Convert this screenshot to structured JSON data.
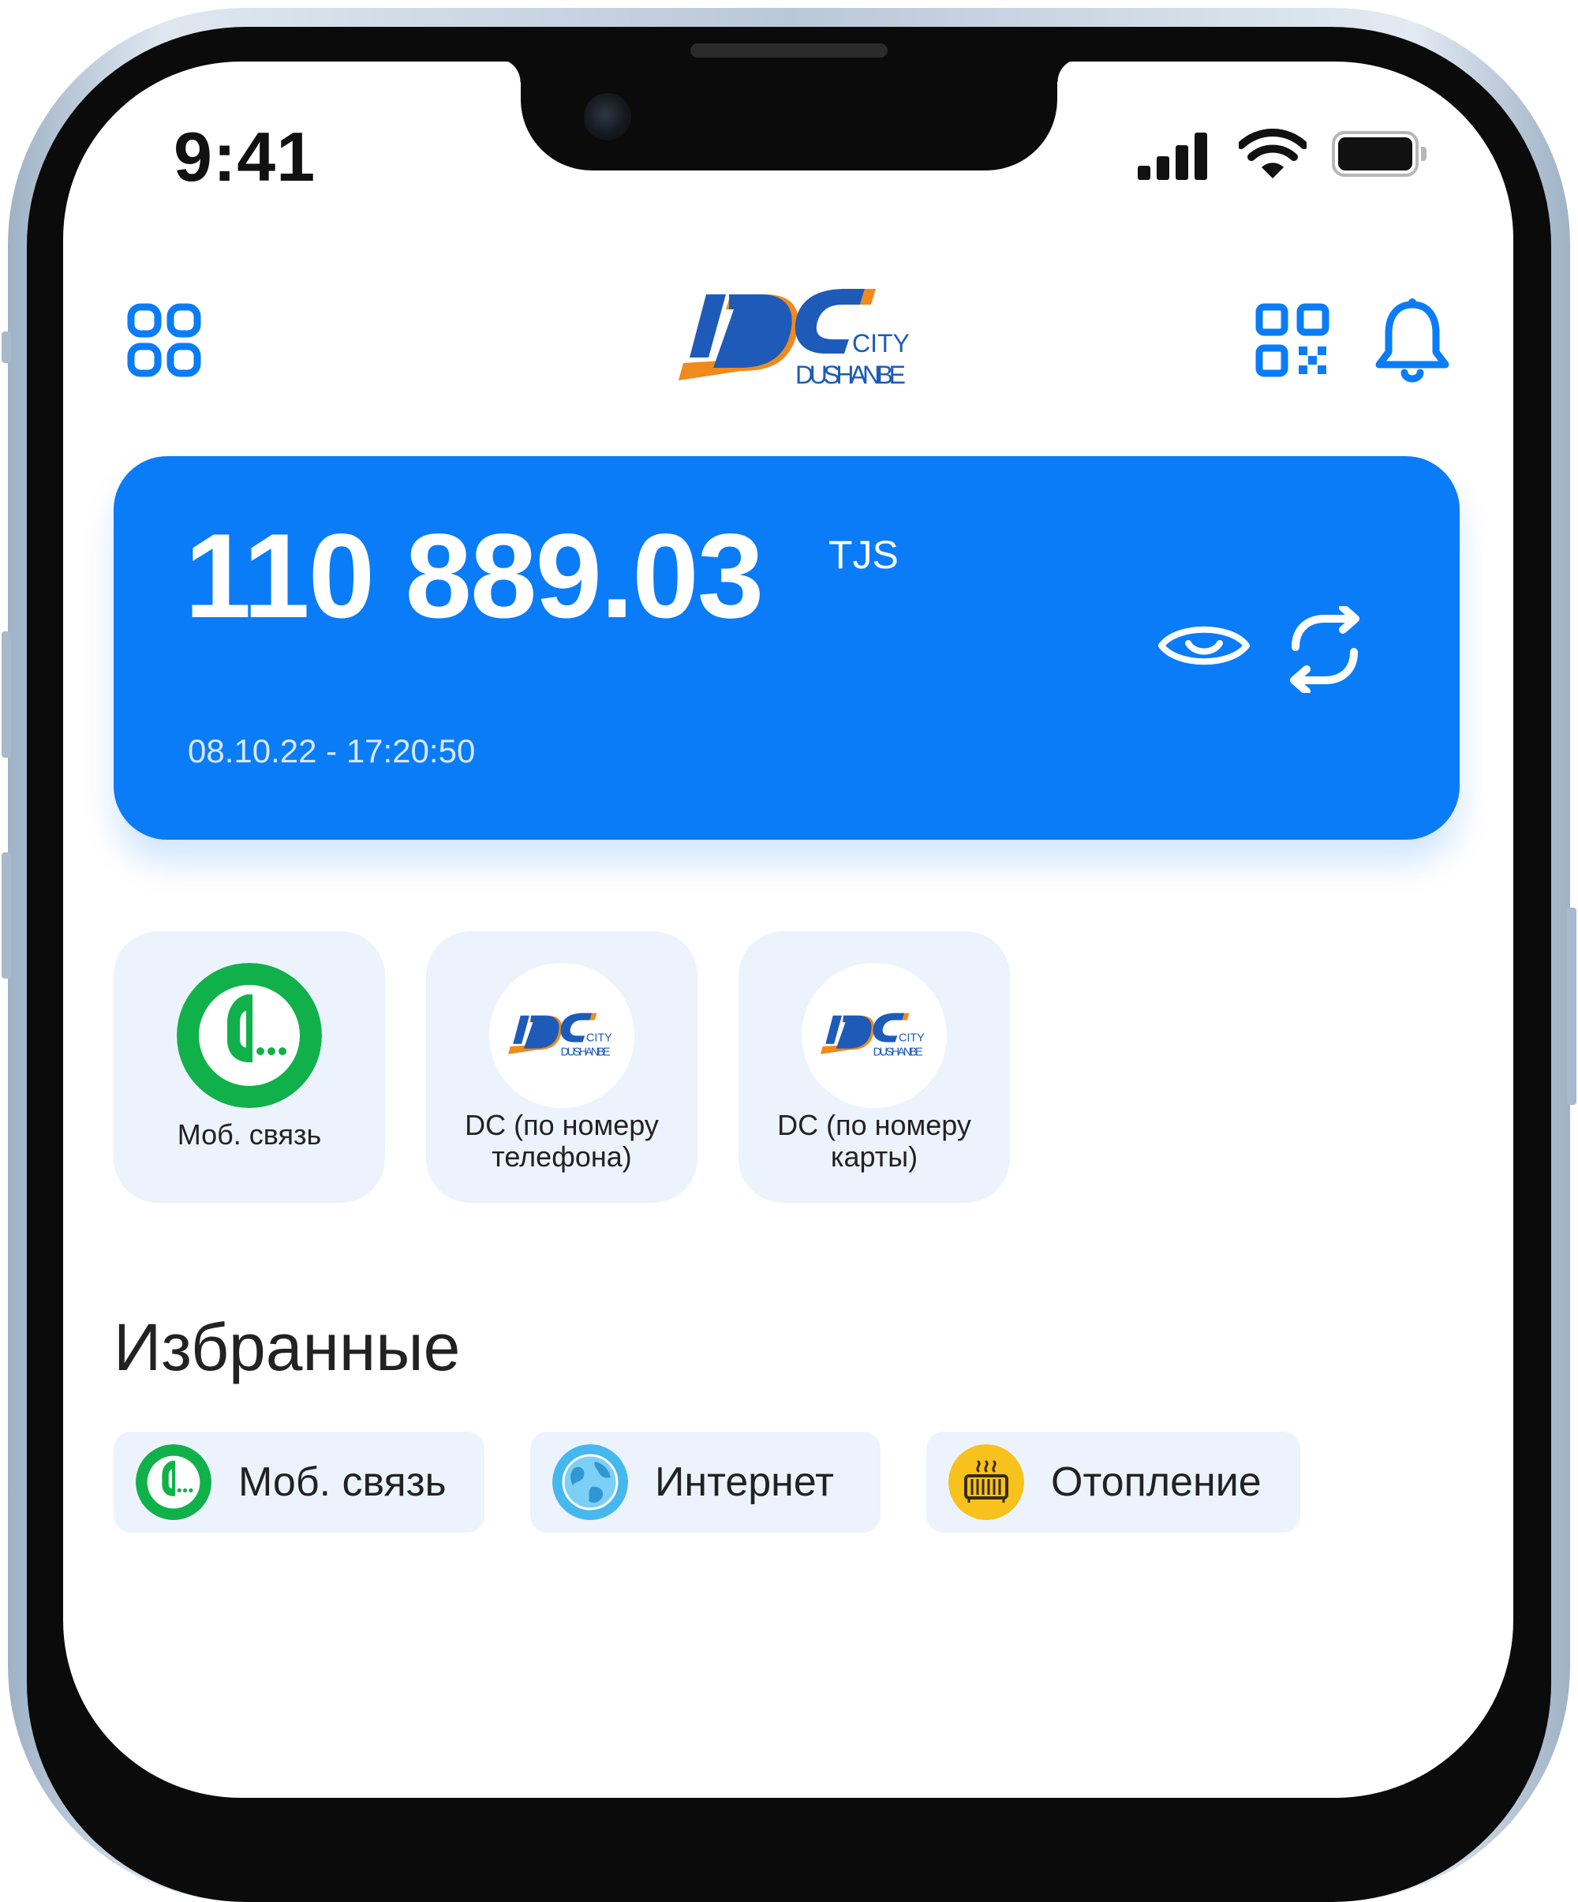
{
  "status_bar": {
    "time": "9:41"
  },
  "header": {
    "logo_text_top": "CITY",
    "logo_text_bottom": "DUSHANBE"
  },
  "balance": {
    "amount": "110 889.03",
    "currency": "TJS",
    "updated": "08.10.22 - 17:20:50"
  },
  "services": [
    {
      "label": "Моб. связь",
      "icon": "megafon-logo"
    },
    {
      "label": "DC (по номеру телефона)",
      "icon": "dc-city-logo"
    },
    {
      "label": "DC (по номеру карты)",
      "icon": "dc-city-logo"
    }
  ],
  "favorites": {
    "title": "Избранные",
    "items": [
      {
        "label": "Моб. связь",
        "icon": "megafon-logo"
      },
      {
        "label": "Интернет",
        "icon": "globe-icon"
      },
      {
        "label": "Отопление",
        "icon": "heater-icon"
      }
    ]
  },
  "colors": {
    "accent": "#0A7CF7",
    "tile_bg": "#EDF3FD",
    "megafon_green": "#10B14A",
    "dc_orange": "#F08A1C",
    "dc_blue": "#1E5BB8",
    "heating_yellow": "#F6C21B",
    "internet_blue": "#45B8EE"
  }
}
